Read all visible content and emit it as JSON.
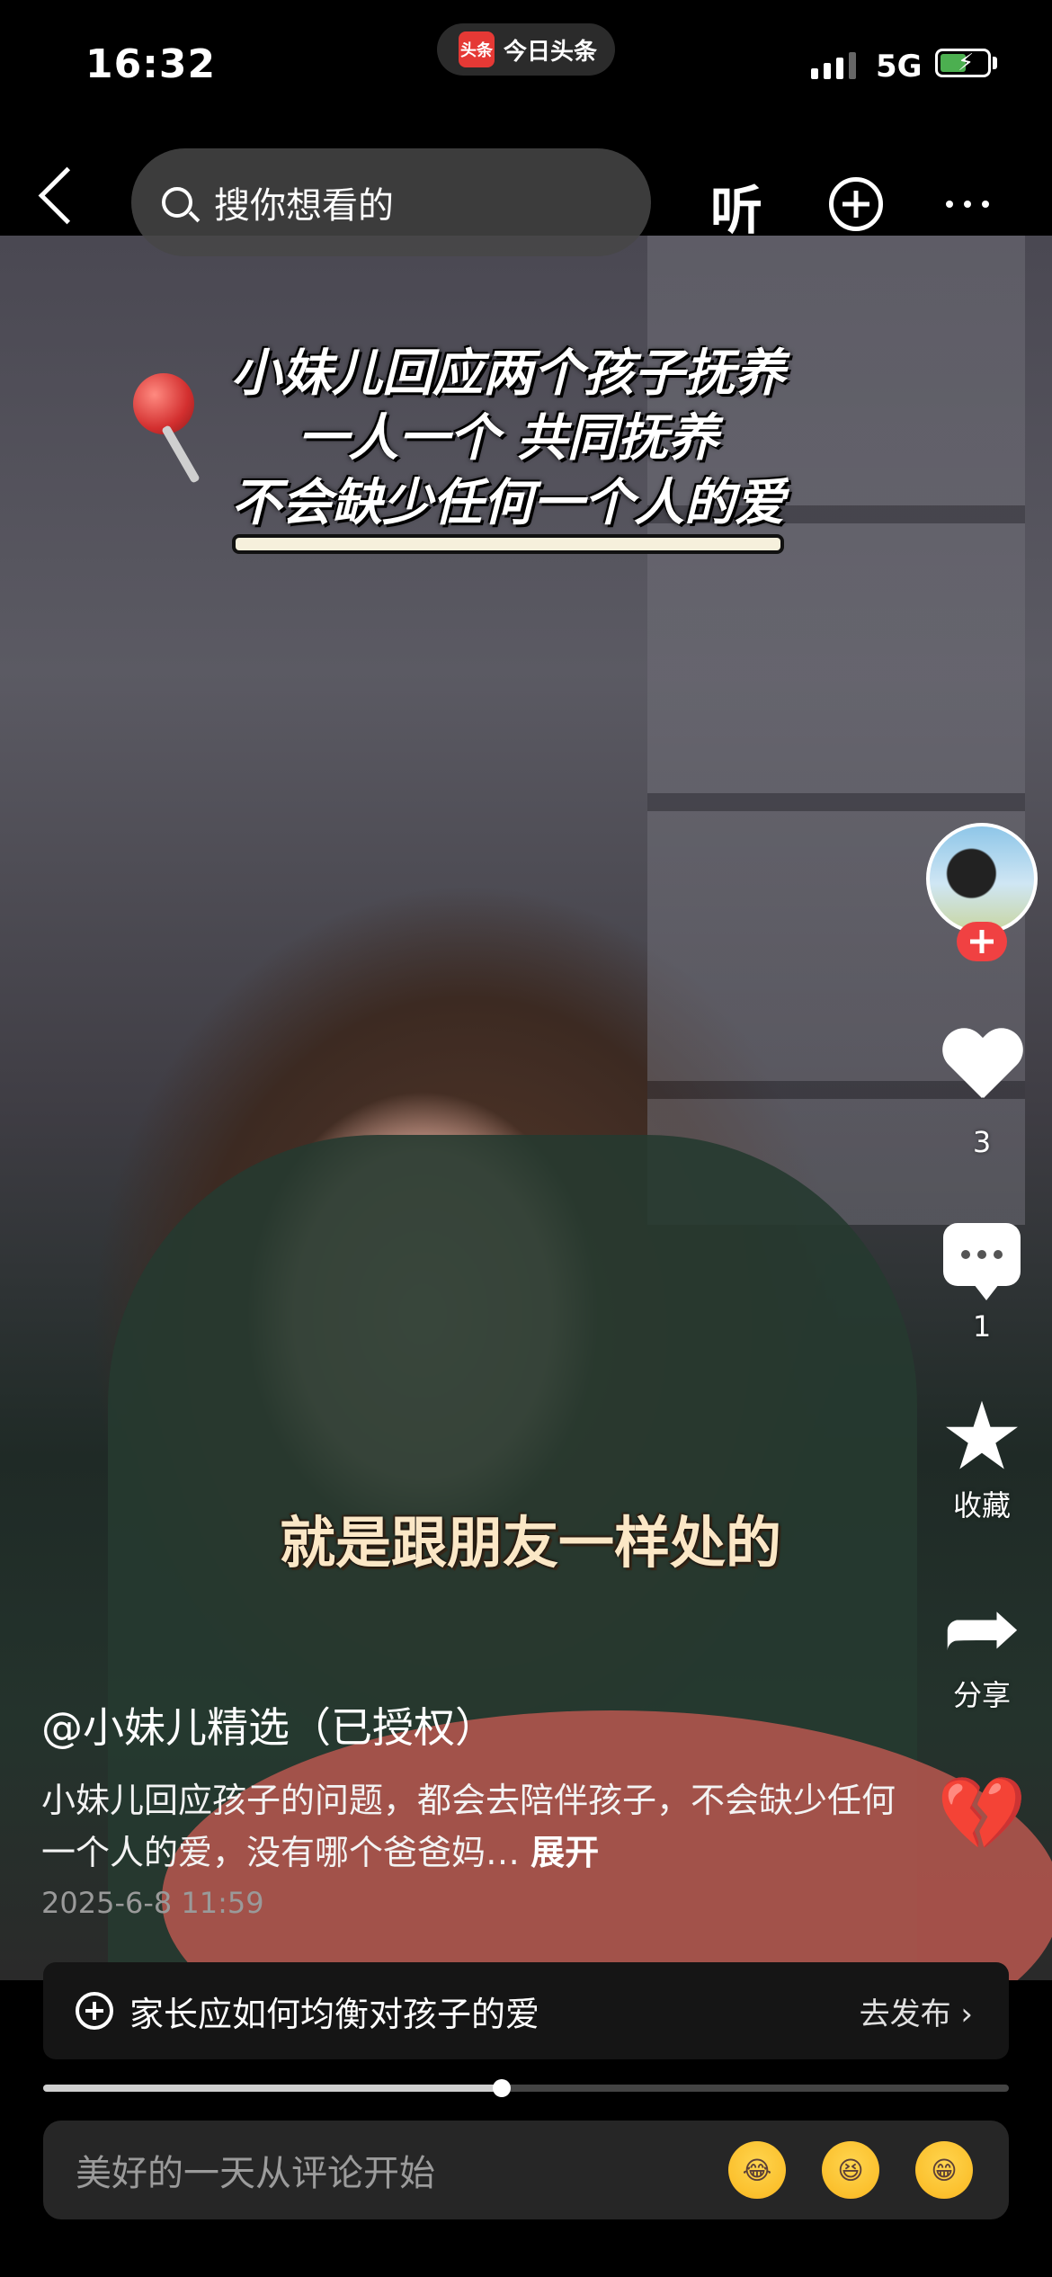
{
  "status_bar": {
    "time": "16:32",
    "app_pill": {
      "logo_text": "头条",
      "label": "今日头条"
    },
    "network": "5G",
    "battery_fill_fraction": 0.55
  },
  "nav": {
    "search_placeholder": "搜你想看的",
    "listen_label": "听"
  },
  "video": {
    "overlay_title_lines": [
      "小妹儿回应两个孩子抚养",
      "一人一个 共同抚养",
      "不会缺少任何一个人的爱"
    ],
    "subtitle": "就是跟朋友一样处的"
  },
  "side_actions": {
    "like_count": "3",
    "comment_count": "1",
    "favorite_label": "收藏",
    "share_label": "分享"
  },
  "caption": {
    "author": "@小妹儿精选（已授权）",
    "description": "小妹儿回应孩子的问题，都会去陪伴孩子，不会缺少任何一个人的爱，没有哪个爸爸妈…",
    "expand_label": "展开",
    "date": "2025-6-8 11:59"
  },
  "topic_bar": {
    "text": "家长应如何均衡对孩子的爱",
    "publish_label": "去发布 ›"
  },
  "playback": {
    "progress_fraction": 0.475
  },
  "comment_box": {
    "placeholder": "美好的一天从评论开始",
    "emojis": [
      "laughing-crying-emoji",
      "grinning-emoji",
      "grimacing-emoji"
    ]
  }
}
